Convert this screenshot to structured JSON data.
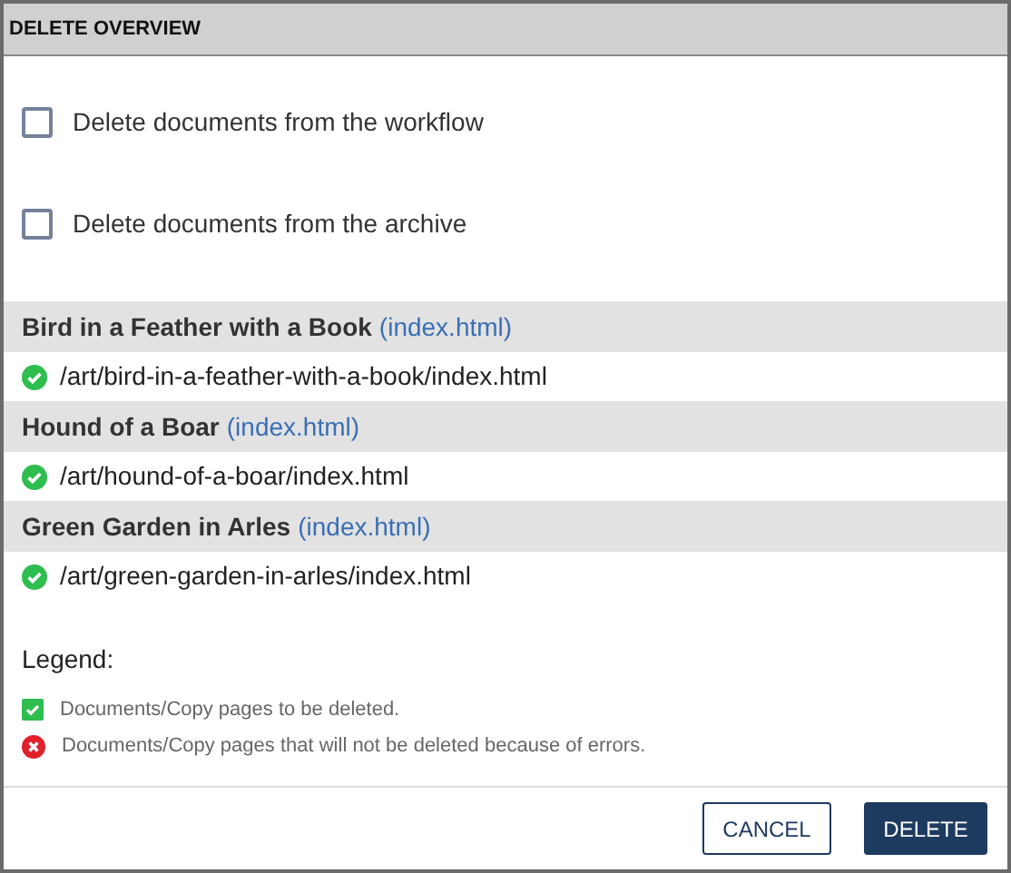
{
  "title": "DELETE OVERVIEW",
  "options": [
    {
      "label": "Delete documents from the workflow",
      "checked": false
    },
    {
      "label": "Delete documents from the archive",
      "checked": false
    }
  ],
  "documents": [
    {
      "title": "Bird in a Feather with a Book",
      "link": "(index.html)",
      "items": [
        {
          "kind": "ok",
          "path": "/art/bird-in-a-feather-with-a-book/index.html"
        }
      ]
    },
    {
      "title": "Hound of a Boar",
      "link": "(index.html)",
      "items": [
        {
          "kind": "ok",
          "path": "/art/hound-of-a-boar/index.html"
        }
      ]
    },
    {
      "title": "Green Garden in Arles",
      "link": "(index.html)",
      "items": [
        {
          "kind": "ok",
          "path": "/art/green-garden-in-arles/index.html"
        }
      ]
    }
  ],
  "legend": {
    "title": "Legend:",
    "items": [
      {
        "kind": "ok",
        "text": "Documents/Copy pages to be deleted."
      },
      {
        "kind": "error",
        "text": "Documents/Copy pages that will not be deleted because of errors."
      }
    ]
  },
  "buttons": [
    {
      "kind": "secondary",
      "label": "CANCEL"
    },
    {
      "kind": "primary",
      "label": "DELETE"
    }
  ]
}
